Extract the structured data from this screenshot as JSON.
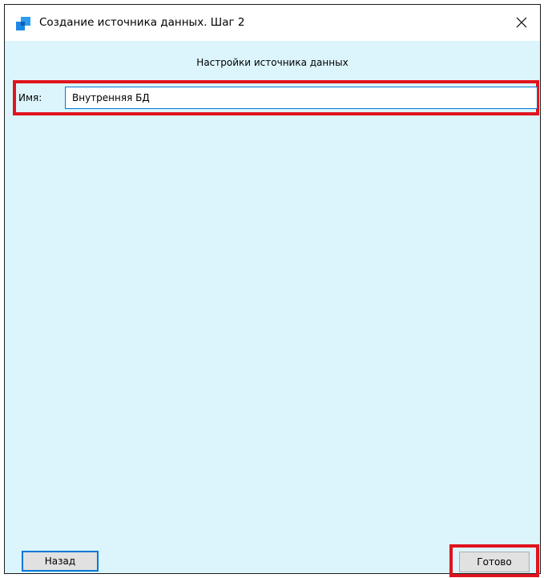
{
  "window": {
    "title": "Создание источника данных. Шаг 2",
    "icon": "app-icon",
    "close_icon": "close-icon"
  },
  "content": {
    "section_title": "Настройки источника данных",
    "name_field": {
      "label": "Имя:",
      "value": "Внутренняя БД"
    }
  },
  "footer": {
    "back_label": "Назад",
    "done_label": "Готово"
  },
  "colors": {
    "background": "#dcf5fc",
    "highlight": "#e0141e",
    "focus_border": "#0078d7",
    "button_face": "#e1e1e1"
  }
}
